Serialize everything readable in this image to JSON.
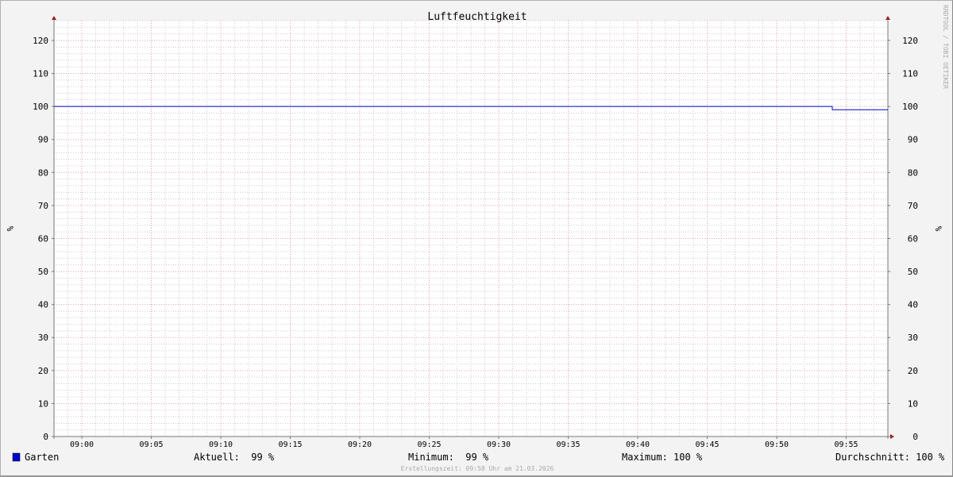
{
  "chart_data": {
    "type": "line",
    "title": "Luftfeuchtigkeit",
    "ylabel": "%",
    "ylabel_right": "%",
    "ylim": [
      0,
      126
    ],
    "yticks": [
      0,
      10,
      20,
      30,
      40,
      50,
      60,
      70,
      80,
      90,
      100,
      110,
      120
    ],
    "xlim": [
      "08:58",
      "09:58"
    ],
    "xticks": [
      "09:00",
      "09:05",
      "09:10",
      "09:15",
      "09:20",
      "09:25",
      "09:30",
      "09:35",
      "09:40",
      "09:45",
      "09:50",
      "09:55"
    ],
    "grid": true,
    "series": [
      {
        "name": "Garten",
        "color": "#0000cc",
        "x": [
          "08:58",
          "09:54",
          "09:54",
          "09:58"
        ],
        "values": [
          100,
          100,
          99,
          99
        ]
      }
    ],
    "legend": {
      "aktuell": "Aktuell:  99 %",
      "minimum": "Minimum:  99 %",
      "maximum": "Maximum: 100 %",
      "durchschnitt": "Durchschnitt: 100 %"
    },
    "footer": "Erstellungszeit: 09:58 Uhr am 21.03.2026",
    "watermark": "RRDTOOL / TOBI OETIKER"
  }
}
